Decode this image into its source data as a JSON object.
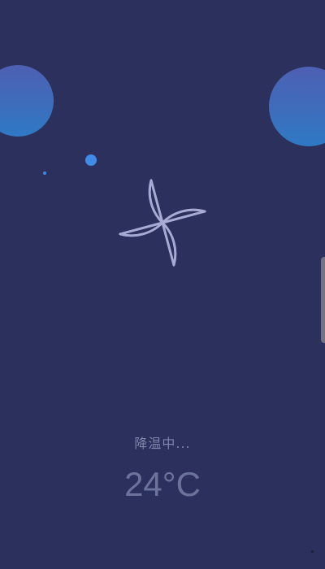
{
  "app": {
    "status": "降温中...",
    "temperature": "24°C",
    "icon": "pinwheel-fan-icon"
  },
  "colors": {
    "background": "#2b305c",
    "bubble_top": "#4e5fb2",
    "bubble_bottom": "#2f79c4",
    "accent_dot": "#3f8be6",
    "fan_stroke": "#a7abd3",
    "status_text": "#7f86aa",
    "temperature_text": "#6b739b"
  }
}
